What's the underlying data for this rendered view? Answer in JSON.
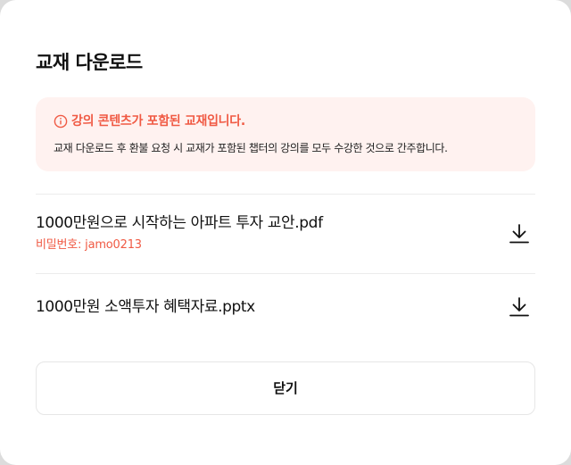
{
  "dialog": {
    "title": "교재 다운로드",
    "notice": {
      "icon": "info-icon",
      "title": "강의 콘텐츠가 포함된 교재입니다.",
      "body": "교재 다운로드 후 환불 요청 시 교재가 포함된 챕터의 강의를 모두 수강한 것으로 간주합니다."
    },
    "files": [
      {
        "name": "1000만원으로 시작하는 아파트 투자 교안.pdf",
        "password": "비밀번호: jamo0213",
        "action_icon": "download-icon"
      },
      {
        "name": "1000만원 소액투자 혜택자료.pptx",
        "action_icon": "download-icon"
      }
    ],
    "close_label": "닫기"
  },
  "colors": {
    "accent": "#f05a44",
    "notice_bg": "#fff2f0",
    "text": "#111111",
    "divider": "#ececec"
  }
}
